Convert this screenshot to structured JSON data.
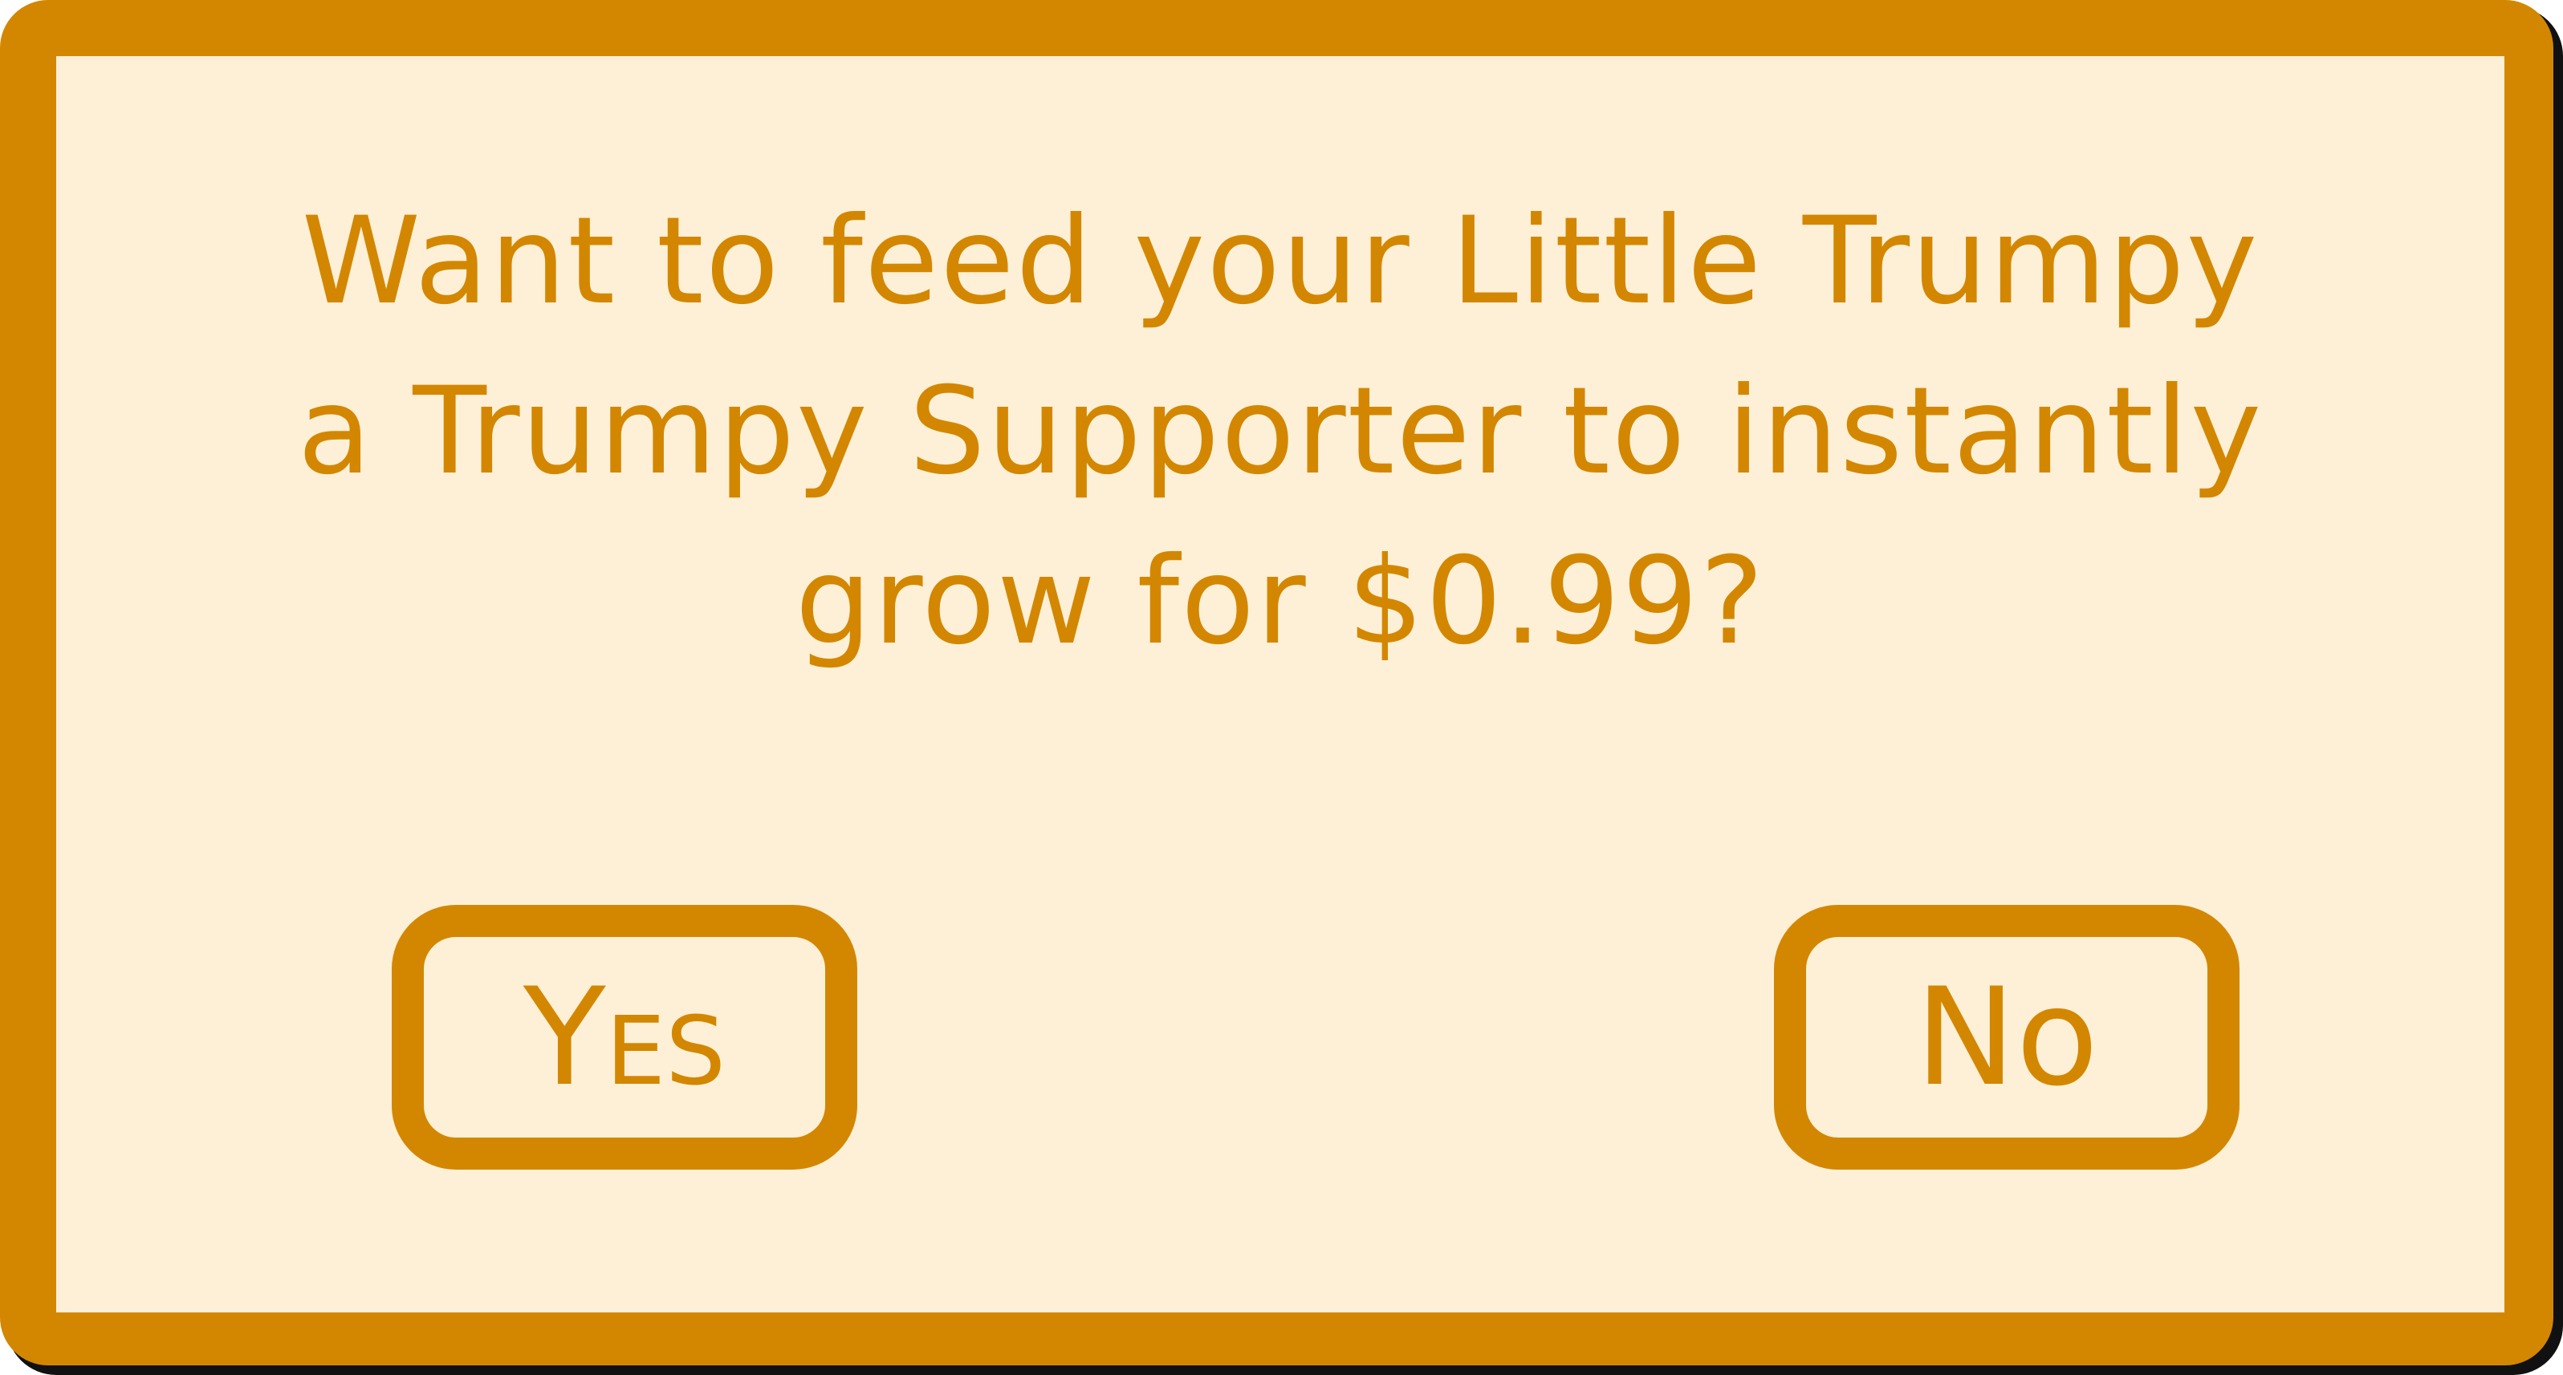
{
  "dialog": {
    "message_lines": [
      "Want to feed your Little Trumpy",
      "a Trumpy Supporter to instantly",
      "grow for $0.99?"
    ],
    "yes_label": "Yes",
    "no_label": "No"
  },
  "colors": {
    "accent": "#D38700",
    "background": "#FEF0D7",
    "shadow": "#111111"
  }
}
